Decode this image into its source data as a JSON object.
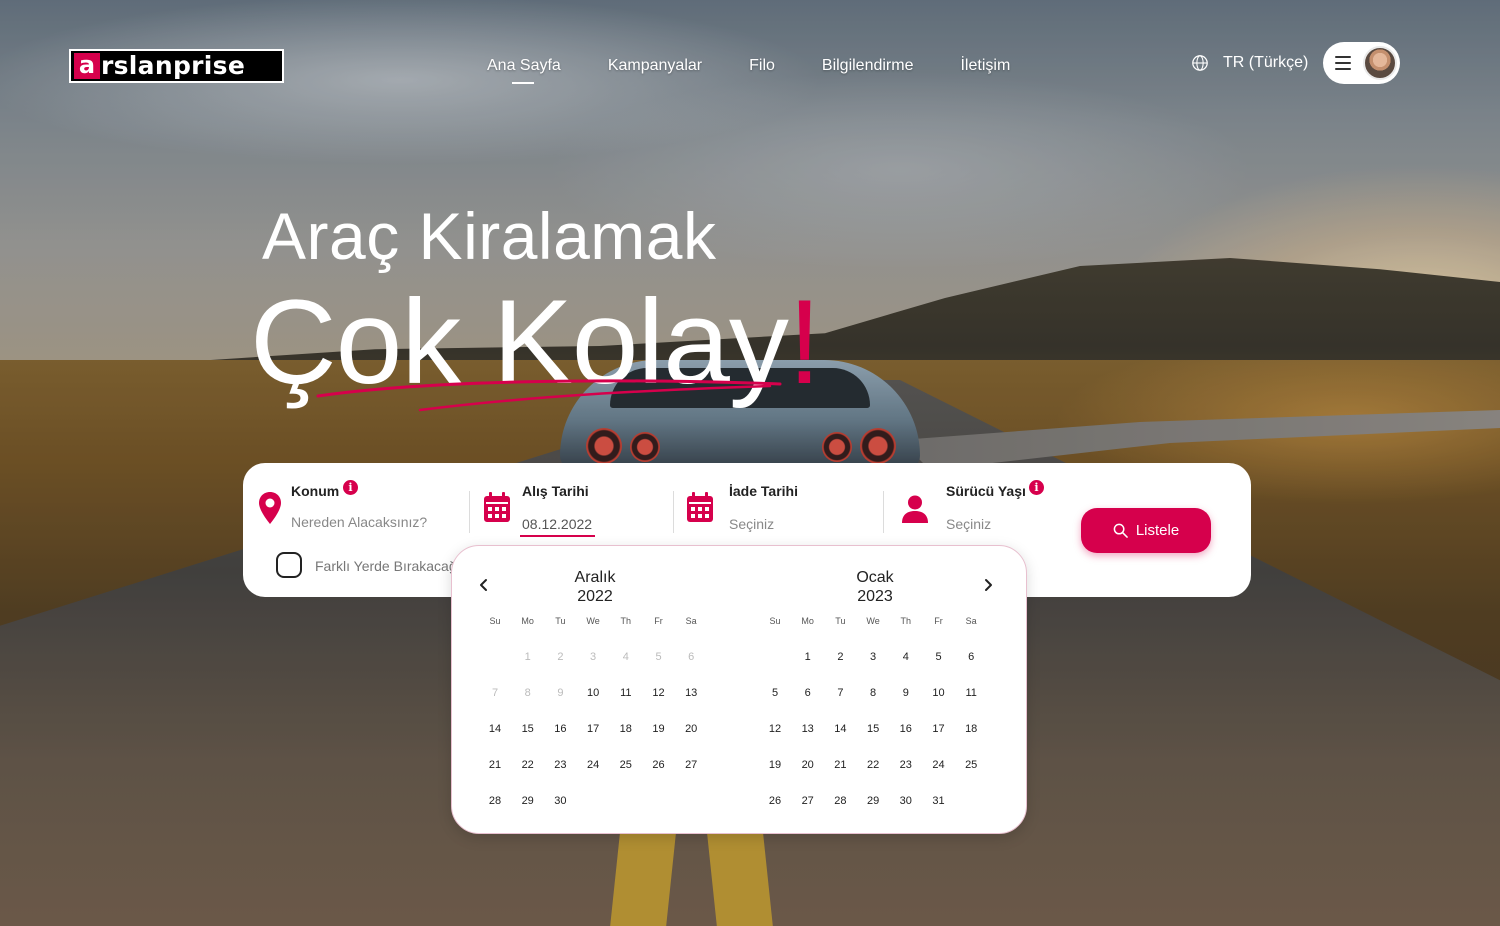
{
  "brand": {
    "logo_text": "rslanprise",
    "logo_mark": "a",
    "accent_color": "#d6004c"
  },
  "nav": {
    "items": [
      {
        "label": "Ana Sayfa",
        "active": true
      },
      {
        "label": "Kampanyalar",
        "active": false
      },
      {
        "label": "Filo",
        "active": false
      },
      {
        "label": "Bilgilendirme",
        "active": false
      },
      {
        "label": "İletişim",
        "active": false
      }
    ]
  },
  "language": {
    "label": "TR (Türkçe)",
    "icon": "globe-icon"
  },
  "user_menu": {
    "menu_icon": "hamburger-icon",
    "avatar": "user-avatar"
  },
  "hero": {
    "line1": "Araç Kiralamak",
    "line2": "Çok Kolay",
    "exclamation": "!"
  },
  "search": {
    "location": {
      "label": "Konum",
      "placeholder": "Nereden Alacaksınız?",
      "icon": "map-pin-icon"
    },
    "pickup_date": {
      "label": "Alış Tarihi",
      "value": "08.12.2022",
      "icon": "calendar-icon"
    },
    "return_date": {
      "label": "İade Tarihi",
      "placeholder": "Seçiniz",
      "icon": "calendar-icon"
    },
    "driver_age": {
      "label": "Sürücü Yaşı",
      "placeholder": "Seçiniz",
      "icon": "user-icon"
    },
    "different_dropoff": {
      "label": "Farklı Yerde Bırakacağım",
      "checked": false
    },
    "submit_label": "Listele"
  },
  "calendar": {
    "weekdays": [
      "Su",
      "Mo",
      "Tu",
      "We",
      "Th",
      "Fr",
      "Sa"
    ],
    "months": [
      {
        "name": "Aralık",
        "year": "2022",
        "weeks": [
          [
            "",
            "1",
            "2",
            "3",
            "4",
            "5",
            "6"
          ],
          [
            "7",
            "8",
            "9",
            "10",
            "11",
            "12",
            "13"
          ],
          [
            "14",
            "15",
            "16",
            "17",
            "18",
            "19",
            "20"
          ],
          [
            "21",
            "22",
            "23",
            "24",
            "25",
            "26",
            "27"
          ],
          [
            "28",
            "29",
            "30",
            "",
            "",
            "",
            ""
          ]
        ],
        "disabled_through": 9
      },
      {
        "name": "Ocak",
        "year": "2023",
        "weeks": [
          [
            "",
            "1",
            "2",
            "3",
            "4",
            "5",
            "6"
          ],
          [
            "5",
            "6",
            "7",
            "8",
            "9",
            "10",
            "11"
          ],
          [
            "12",
            "13",
            "14",
            "15",
            "16",
            "17",
            "18"
          ],
          [
            "19",
            "20",
            "21",
            "22",
            "23",
            "24",
            "25"
          ],
          [
            "26",
            "27",
            "28",
            "29",
            "30",
            "31",
            ""
          ]
        ],
        "disabled_through": 0
      }
    ]
  }
}
